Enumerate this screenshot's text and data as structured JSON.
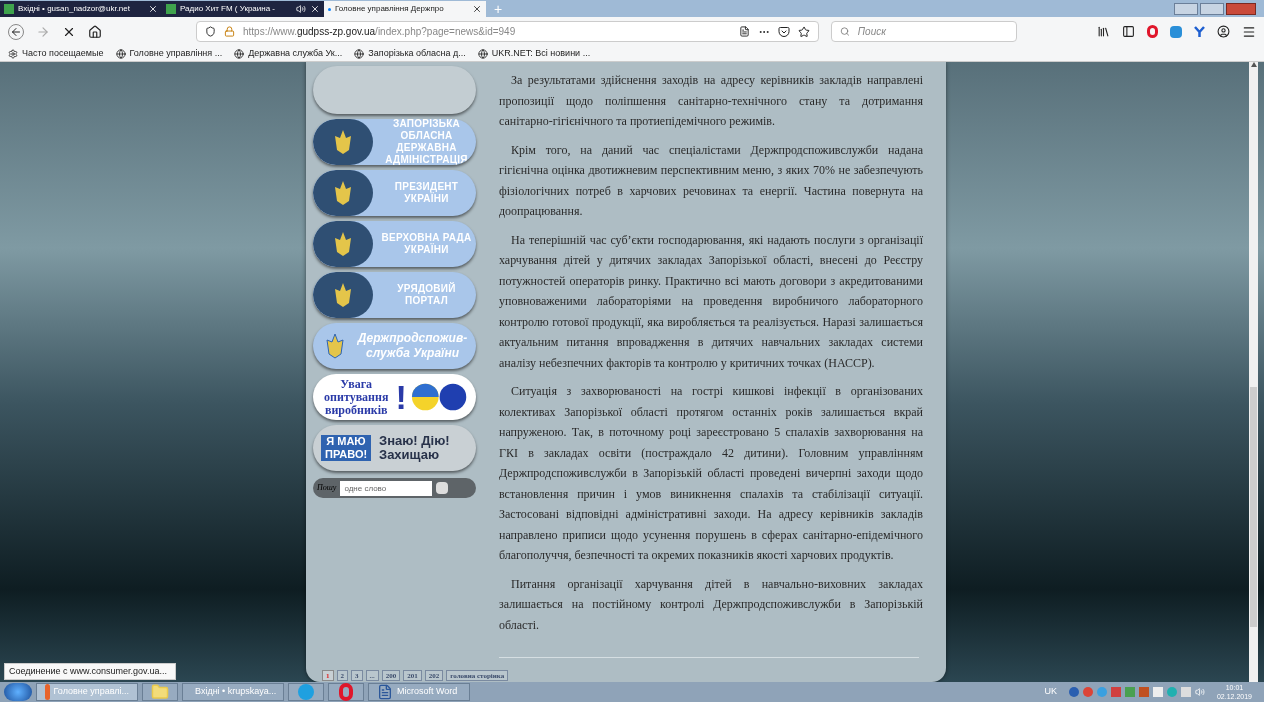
{
  "tabs": [
    {
      "label": "Вхідні • gusan_nadzor@ukr.net",
      "selected": false,
      "audio": false
    },
    {
      "label": "Радио Хит FM ( Украина - ",
      "selected": false,
      "audio": true
    },
    {
      "label": "Головне управління Держпро",
      "selected": true,
      "audio": false
    }
  ],
  "new_tab": "+",
  "address_bar": {
    "url_prefix": "https://www.",
    "url_domain": "gudpss-zp.gov.ua",
    "url_path": "/index.php?page=news&id=949"
  },
  "search": {
    "placeholder": "Поиск"
  },
  "bookmarks": [
    "Часто посещаемые",
    "Головне управління ...",
    "Державна служба Ук...",
    "Запорізька обласна д...",
    "UKR.NET: Всі новини ..."
  ],
  "banners": [
    {
      "kind": "blank"
    },
    {
      "kind": "caps",
      "text": "ЗАПОРІЗЬКА ОБЛАСНА ДЕРЖАВНА АДМІНІСТРАЦІЯ"
    },
    {
      "kind": "caps",
      "text": "ПРЕЗИДЕНТ УКРАЇНИ"
    },
    {
      "kind": "caps",
      "text": "ВЕРХОВНА РАДА УКРАЇНИ"
    },
    {
      "kind": "caps",
      "text": "УРЯДОВИЙ ПОРТАЛ"
    },
    {
      "kind": "italic",
      "text": "Держпродспожив-служба України"
    },
    {
      "kind": "survey",
      "text": "Увага опитування виробників",
      "mark": "!"
    },
    {
      "kind": "rights",
      "text": "Я МАЮ ПРАВО!",
      "slogan": "Знаю! Дію! Захищаю"
    }
  ],
  "site_search": {
    "label": "Пошу",
    "placeholder": "одне слово"
  },
  "article": [
    "За результатами здійснення заходів на адресу керівників закладів направлені пропозиції щодо поліпшення санітарно-технічного стану та дотримання санітарно-гігієнічного та протиепідемічного режимів.",
    "Крім того, на даний час спеціалістами Держпродспоживслужби надана гігієнічна оцінка двотижневим перспективним меню, з яких 70% не забезпечують фізіологічних потреб в харчових речовинах та енергії. Частина повернута на доопрацювання.",
    "На теперішній час суб’єкти господарювання, які надають послуги з організації харчування дітей у дитячих закладах Запорізької області, внесені до Реєстру потужностей операторів ринку. Практично всі мають договори з акредитованими уповноваженими лабораторіями на проведення виробничого лабораторного контролю готової продукції, яка виробляється та реалізується. Наразі залишається актуальним питання впровадження в дитячих навчальних закладах системи аналізу небезпечних факторів та контролю у критичних точках (НАССР).",
    "Ситуація з захворюваності на гострі кишкові інфекції в організованих колективах Запорізької області протягом останніх років залишається вкрай напруженою. Так, в поточному році зареєстровано 5 спалахів захворювання на ГКІ в закладах освіти (постраждало 42 дитини). Головним управлінням Держпродспоживслужби в Запорізькій області проведені вичерпні заходи щодо встановлення причин і умов виникнення спалахів та стабілізації ситуації. Застосовані відповідні адміністративні заходи. На адресу  керівників закладів направлено приписи щодо усунення порушень в сферах санітарно-епідемічного благополуччя, безпечності та окремих показників якості харчових продуктів.",
    "Питання організації харчування дітей в навчально-виховних закладах залишається на постійному контролі Держпродспоживслужби в Запорізькій області."
  ],
  "pagination": [
    {
      "label": "1",
      "selected": true
    },
    {
      "label": "2",
      "selected": false
    },
    {
      "label": "3",
      "selected": false
    },
    {
      "label": "...",
      "selected": false
    },
    {
      "label": "200",
      "selected": false
    },
    {
      "label": "201",
      "selected": false
    },
    {
      "label": "202",
      "selected": false
    },
    {
      "label": "головна сторінка",
      "selected": false
    }
  ],
  "status_text": "Соединение с www.consumer.gov.ua...",
  "taskbar": [
    {
      "kind": "firefox",
      "label": "Головне управлі...",
      "selected": true
    },
    {
      "kind": "folder",
      "selected": false
    },
    {
      "kind": "chrome",
      "label": "Вхідні • krupskaya...",
      "selected": false
    },
    {
      "kind": "q",
      "selected": false
    },
    {
      "kind": "opera",
      "selected": false
    },
    {
      "kind": "word",
      "label": "Microsoft Word",
      "selected": false
    }
  ],
  "tray": {
    "language": "UK",
    "time": "10:01",
    "date": "02.12.2019"
  }
}
